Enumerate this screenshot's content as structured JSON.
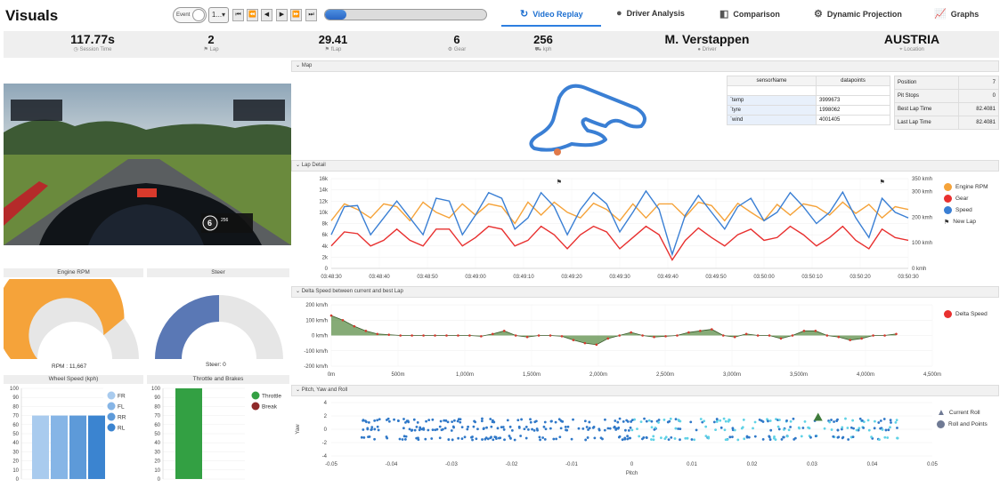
{
  "app": {
    "title": "Visuals"
  },
  "controls": {
    "event_toggle_label": "Event",
    "speed_select_value": "1...",
    "progress_value": 0.13
  },
  "nav": [
    {
      "label": "Video Replay",
      "icon": "replay-icon",
      "active": true
    },
    {
      "label": "Driver Analysis",
      "icon": "driver-icon",
      "active": false
    },
    {
      "label": "Comparison",
      "icon": "comparison-icon",
      "active": false
    },
    {
      "label": "Dynamic Projection",
      "icon": "projection-icon",
      "active": false
    },
    {
      "label": "Graphs",
      "icon": "graphs-icon",
      "active": false
    }
  ],
  "stats": {
    "session_time": {
      "value": "117.77s",
      "label": "Session Time"
    },
    "lap": {
      "value": "2",
      "label": "Lap"
    },
    "flap": {
      "value": "29.41",
      "label": "fLap"
    },
    "gear": {
      "value": "6",
      "label": "Gear"
    },
    "kph": {
      "value": "256",
      "label": "kph"
    },
    "driver": {
      "value": "M. Verstappen",
      "label": "Driver"
    },
    "location": {
      "value": "AUSTRIA",
      "label": "Location"
    }
  },
  "panels": {
    "map": "Map",
    "lap_detail": "Lap Detail",
    "delta_speed": "Delta Speed between current and best Lap",
    "pitch_yaw": "Pitch, Yaw and Roll"
  },
  "sensor_table": {
    "headers": [
      "sensorName",
      "datapoints"
    ],
    "rows": [
      [
        "`temp",
        "3999673"
      ],
      [
        "`tyre",
        "1998062"
      ],
      [
        "`wind",
        "4001405"
      ]
    ]
  },
  "race_table": {
    "rows": [
      [
        "Position",
        "7"
      ],
      [
        "Pit Stops",
        "0"
      ],
      [
        "Best Lap Time",
        "82.4081"
      ],
      [
        "Last Lap Time",
        "82.4081"
      ]
    ]
  },
  "gauges": {
    "rpm": {
      "title": "Engine RPM",
      "caption": "RPM : 11,667",
      "fraction": 0.78
    },
    "steer": {
      "title": "Steer",
      "caption": "Steer: 0",
      "fraction": 0.5
    }
  },
  "wheel_speed": {
    "title": "Wheel Speed (kph)",
    "y_ticks": [
      "100",
      "90",
      "80",
      "70",
      "60",
      "50",
      "40",
      "30",
      "20",
      "10",
      "0"
    ],
    "legend": [
      "FR",
      "FL",
      "RR",
      "RL"
    ],
    "colors": [
      "#a9cbee",
      "#86b5e6",
      "#5d9ad9",
      "#3b84d0"
    ],
    "values": [
      70,
      70,
      70,
      70
    ]
  },
  "throttle": {
    "title": "Throttle and Brakes",
    "y_ticks": [
      "100",
      "90",
      "80",
      "70",
      "60",
      "50",
      "40",
      "30",
      "20",
      "10",
      "0"
    ],
    "legend": [
      "Throttle",
      "Break"
    ],
    "colors": [
      "#33a043",
      "#8f2a2a"
    ],
    "values": [
      100,
      0
    ]
  },
  "video": {
    "hud_gear": "6",
    "hud_speed": "256"
  },
  "chart_data": [
    {
      "type": "line",
      "name": "lap-detail",
      "x_ticks": [
        "03:48:30",
        "03:48:40",
        "03:48:50",
        "03:49:00",
        "03:49:10",
        "03:49:20",
        "03:49:30",
        "03:49:40",
        "03:49:50",
        "03:50:00",
        "03:50:10",
        "03:50:20",
        "03:50:30"
      ],
      "y_ticks_left": [
        "16k",
        "14k",
        "12k",
        "10k",
        "8k",
        "6k",
        "4k",
        "2k",
        "0"
      ],
      "y_ticks_right": [
        "350 kmh",
        "300 kmh",
        "200 kmh",
        "100 kmh",
        "0 kmh"
      ],
      "legend": [
        "Engine RPM",
        "Gear",
        "Speed",
        "New Lap"
      ],
      "colors": {
        "rpm": "#f5a33a",
        "gear": "#e8302f",
        "speed": "#3a7fd4"
      },
      "series": [
        {
          "name": "Engine RPM",
          "values": [
            8500,
            11500,
            10500,
            9000,
            11500,
            11000,
            8500,
            11800,
            10000,
            9000,
            11500,
            9500,
            11500,
            11000,
            8000,
            11800,
            9500,
            11800,
            10000,
            9000,
            11600,
            10500,
            8500,
            11500,
            9000,
            11500,
            11500,
            9200,
            11800,
            11200,
            8500,
            11600,
            10000,
            8500,
            11400,
            9500,
            11500,
            11000,
            9500,
            11800,
            9800,
            11400,
            9000,
            11000,
            10500
          ]
        },
        {
          "name": "Speed",
          "values": [
            6000,
            11000,
            11200,
            6000,
            9000,
            12000,
            9000,
            6000,
            12500,
            12000,
            6000,
            9500,
            13500,
            12500,
            7000,
            9000,
            13500,
            11000,
            6000,
            10500,
            13500,
            11500,
            6500,
            10000,
            13800,
            10500,
            2500,
            9500,
            13000,
            10000,
            7000,
            11000,
            12500,
            8500,
            10000,
            13500,
            11000,
            8000,
            10000,
            13600,
            9000,
            5500,
            12500,
            10000,
            9000
          ]
        },
        {
          "name": "Gear",
          "values": [
            4000,
            6500,
            6200,
            4000,
            5000,
            7000,
            5000,
            4000,
            7000,
            7000,
            4000,
            5500,
            7500,
            7000,
            4000,
            5000,
            7500,
            6000,
            3500,
            6000,
            7500,
            6500,
            3500,
            5500,
            7500,
            6000,
            1500,
            5000,
            7200,
            5500,
            4000,
            6000,
            7000,
            5000,
            5500,
            7500,
            6000,
            4000,
            5500,
            7500,
            5000,
            3500,
            7000,
            5500,
            5000
          ]
        }
      ],
      "new_lap_markers": [
        "03:49:02",
        "03:50:20"
      ]
    },
    {
      "type": "area",
      "name": "delta-speed",
      "x_ticks": [
        "0m",
        "500m",
        "1,000m",
        "1,500m",
        "2,000m",
        "2,500m",
        "3,000m",
        "3,500m",
        "4,000m",
        "4,500m"
      ],
      "y_ticks": [
        "200 km/h",
        "100 km/h",
        "0 km/h",
        "-100 km/h",
        "-200 km/h"
      ],
      "legend": [
        "Delta Speed"
      ],
      "values": [
        130,
        100,
        60,
        30,
        10,
        5,
        0,
        0,
        0,
        0,
        0,
        0,
        0,
        -5,
        10,
        30,
        0,
        -10,
        0,
        0,
        -5,
        -30,
        -50,
        -60,
        -20,
        0,
        20,
        0,
        -10,
        -5,
        0,
        20,
        30,
        40,
        0,
        -10,
        10,
        0,
        0,
        -20,
        0,
        30,
        30,
        0,
        -10,
        -30,
        -20,
        0,
        0,
        10
      ]
    },
    {
      "type": "scatter",
      "name": "pitch-yaw-roll",
      "x_ticks": [
        "-0.05",
        "-0.04",
        "-0.03",
        "-0.02",
        "-0.01",
        "0",
        "0.01",
        "0.02",
        "0.03",
        "0.04",
        "0.05"
      ],
      "y_ticks": [
        "4",
        "2",
        "0",
        "-2",
        "-4"
      ],
      "xlabel": "Pitch",
      "ylabel": "Yaw",
      "legend": [
        "Current Roll",
        "Roll and Points"
      ],
      "current": {
        "x": 0.031,
        "y": 1.8
      }
    }
  ]
}
